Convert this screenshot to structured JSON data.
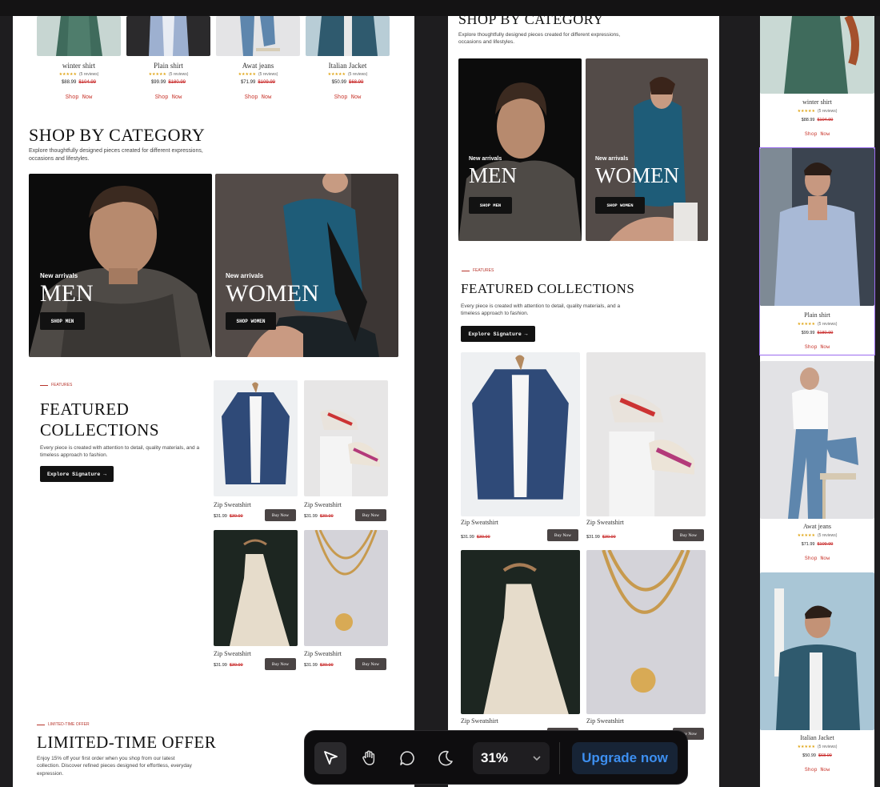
{
  "colors": {
    "accent": "#c8342a",
    "old_price": "#c62020",
    "star": "#e0a516",
    "selection": "#9b6cf0",
    "upgrade": "#3d8ff0"
  },
  "products": [
    {
      "name": "winter shirt",
      "stars": "★★★★★",
      "reviews": "(5 reviews)",
      "price": "$88.99",
      "old_price": "$104.99",
      "shop": "Shop Now"
    },
    {
      "name": "Plain shirt",
      "stars": "★★★★★",
      "reviews": "(5 reviews)",
      "price": "$99.99",
      "old_price": "$180.99",
      "shop": "Shop Now"
    },
    {
      "name": "Awat jeans",
      "stars": "★★★★★",
      "reviews": "(5 reviews)",
      "price": "$71.99",
      "old_price": "$109.99",
      "shop": "Shop Now"
    },
    {
      "name": "Italian Jacket",
      "stars": "★★★★★",
      "reviews": "(5 reviews)",
      "price": "$50.99",
      "old_price": "$68.99",
      "shop": "Shop Now"
    }
  ],
  "category": {
    "title": "SHOP BY CATEGORY",
    "subtitle": "Explore thoughtfully designed pieces created for different expressions, occasions and lifestyles.",
    "men": {
      "label": "New arrivals",
      "big": "MEN",
      "button": "SHOP MEN"
    },
    "women": {
      "label": "New arrivals",
      "big": "WOMEN",
      "button": "SHOP WOMEN"
    }
  },
  "featured": {
    "tag": "FEATURES",
    "title_line1": "FEATURED",
    "title_line2": "COLLECTIONS",
    "title_full": "FEATURED COLLECTIONS",
    "desc": "Every piece is created with attention to detail, quality materials, and a timeless approach to fashion.",
    "button": "Explore Signature →",
    "items": [
      {
        "name": "Zip Sweatshirt",
        "price": "$31.99",
        "old_price": "$39.99",
        "buy": "Buy Now"
      },
      {
        "name": "Zip Sweatshirt",
        "price": "$31.99",
        "old_price": "$39.99",
        "buy": "Buy Now"
      },
      {
        "name": "Zip Sweatshirt",
        "price": "$31.99",
        "old_price": "$39.99",
        "buy": "Buy Now"
      },
      {
        "name": "Zip Sweatshirt",
        "price": "$31.99",
        "old_price": "$39.99",
        "buy": "Buy Now"
      }
    ]
  },
  "offer": {
    "tag": "LIMITED-TIME OFFER",
    "title": "LIMITED-TIME OFFER",
    "desc": "Enjoy 15% off your first order when you shop from our latest collection. Discover refined pieces designed for effortless, everyday expression."
  },
  "toolbar": {
    "tools": [
      "pointer-icon",
      "hand-icon",
      "comment-icon",
      "moon-icon"
    ],
    "zoom": "31%",
    "upgrade": "Upgrade now"
  }
}
